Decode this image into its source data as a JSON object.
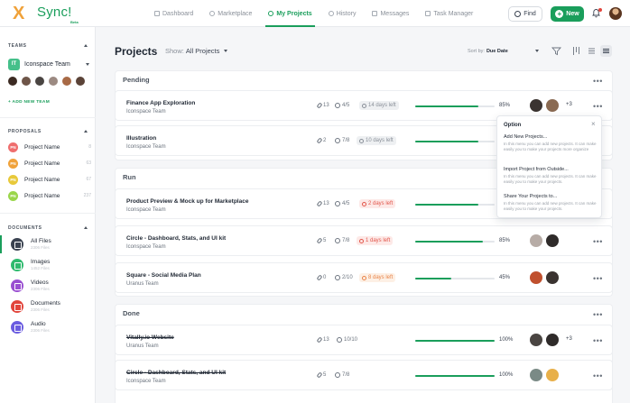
{
  "app": {
    "logo_mark": "X",
    "logo_text": "Sync!",
    "logo_beta": "Beta"
  },
  "nav": {
    "items": [
      {
        "label": "Dashboard",
        "icon": "dashboard-icon"
      },
      {
        "label": "Marketplace",
        "icon": "marketplace-icon"
      },
      {
        "label": "My Projects",
        "icon": "check-circle-icon",
        "active": true
      },
      {
        "label": "History",
        "icon": "history-icon"
      },
      {
        "label": "Messages",
        "icon": "message-icon"
      },
      {
        "label": "Task Manager",
        "icon": "task-icon"
      }
    ],
    "find_label": "Find",
    "new_label": "New"
  },
  "sidebar": {
    "teams_heading": "TEAMS",
    "team": {
      "badge": "IT",
      "name": "Iconspace Team"
    },
    "add_team": "+ ADD NEW TEAM",
    "proposals_heading": "PROPOSALS",
    "proposals": [
      {
        "badge": "PN",
        "name": "Project Name",
        "count": "8",
        "color": "#ef6e6e"
      },
      {
        "badge": "PN",
        "name": "Project Name",
        "count": "63",
        "color": "#f0a23a"
      },
      {
        "badge": "PN",
        "name": "Project Name",
        "count": "67",
        "color": "#e8c93a"
      },
      {
        "badge": "PN",
        "name": "Project Name",
        "count": "237",
        "color": "#9ad64a"
      }
    ],
    "documents_heading": "DOCUMENTS",
    "documents": [
      {
        "name": "All Files",
        "sub": "2306 Files",
        "color": "#3a4250",
        "icon": "grid-icon"
      },
      {
        "name": "Images",
        "sub": "1452 Files",
        "color": "#2fba6e",
        "icon": "image-icon"
      },
      {
        "name": "Videos",
        "sub": "2306 Files",
        "color": "#9a4fd1",
        "icon": "video-icon"
      },
      {
        "name": "Documents",
        "sub": "2306 Files",
        "color": "#e2453c",
        "icon": "document-icon"
      },
      {
        "name": "Audio",
        "sub": "2306 Files",
        "color": "#6a5ce0",
        "icon": "audio-icon"
      }
    ]
  },
  "main": {
    "title": "Projects",
    "show_label": "Show:",
    "show_value": "All Projects",
    "sort_label": "Sort by:",
    "sort_value": "Due Date"
  },
  "groups": [
    {
      "name": "Pending"
    },
    {
      "name": "Run"
    },
    {
      "name": "Done"
    }
  ],
  "rows": [
    {
      "title": "Finance App Exploration",
      "team": "Iconspace Team",
      "attachments": "13",
      "tasks": "4/5",
      "deadline": "14 days left",
      "deadline_style": "grey",
      "progress": 0.8,
      "progress_label": "85%",
      "extra": "+3"
    },
    {
      "title": "Illustration",
      "team": "Iconspace Team",
      "attachments": "2",
      "tasks": "7/8",
      "deadline": "10 days left",
      "deadline_style": "grey",
      "progress": 0.8,
      "progress_label": ""
    },
    {
      "title": "Product Preview & Mock up for Marketplace",
      "team": "Iconspace Team",
      "attachments": "13",
      "tasks": "4/5",
      "deadline": "2 days left",
      "deadline_style": "red",
      "progress": 0.8,
      "progress_label": ""
    },
    {
      "title": "Circle - Dashboard, Stats, and UI kit",
      "team": "Iconspace Team",
      "attachments": "5",
      "tasks": "7/8",
      "deadline": "1 days left",
      "deadline_style": "red",
      "progress": 0.85,
      "progress_label": "85%"
    },
    {
      "title": "Square - Social Media Plan",
      "team": "Uranus Team",
      "attachments": "0",
      "tasks": "2/10",
      "deadline": "8 days left",
      "deadline_style": "orange",
      "progress": 0.45,
      "progress_label": "45%"
    },
    {
      "title": "Vitally.io Website",
      "team": "Uranus Team",
      "attachments": "13",
      "tasks": "10/10",
      "deadline": "",
      "progress": 1.0,
      "progress_label": "100%",
      "extra": "+3",
      "done": true
    },
    {
      "title": "Circle - Dashboard, Stats, and UI kit",
      "team": "Iconspace Team",
      "attachments": "5",
      "tasks": "7/8",
      "deadline": "",
      "progress": 1.0,
      "progress_label": "100%",
      "done": true
    }
  ],
  "popover": {
    "title": "Option",
    "items": [
      {
        "title": "Add New Projects...",
        "desc": "In this menu you can add new projects. It can make easily you to make your projects more organize"
      },
      {
        "title": "Import Project from Outside...",
        "desc": "In this menu you can add new projects. It can make easily you to make your projects."
      },
      {
        "title": "Share Your Projects to...",
        "desc": "In this menu you can add new projects. It can make easily you to make your projects."
      }
    ]
  }
}
